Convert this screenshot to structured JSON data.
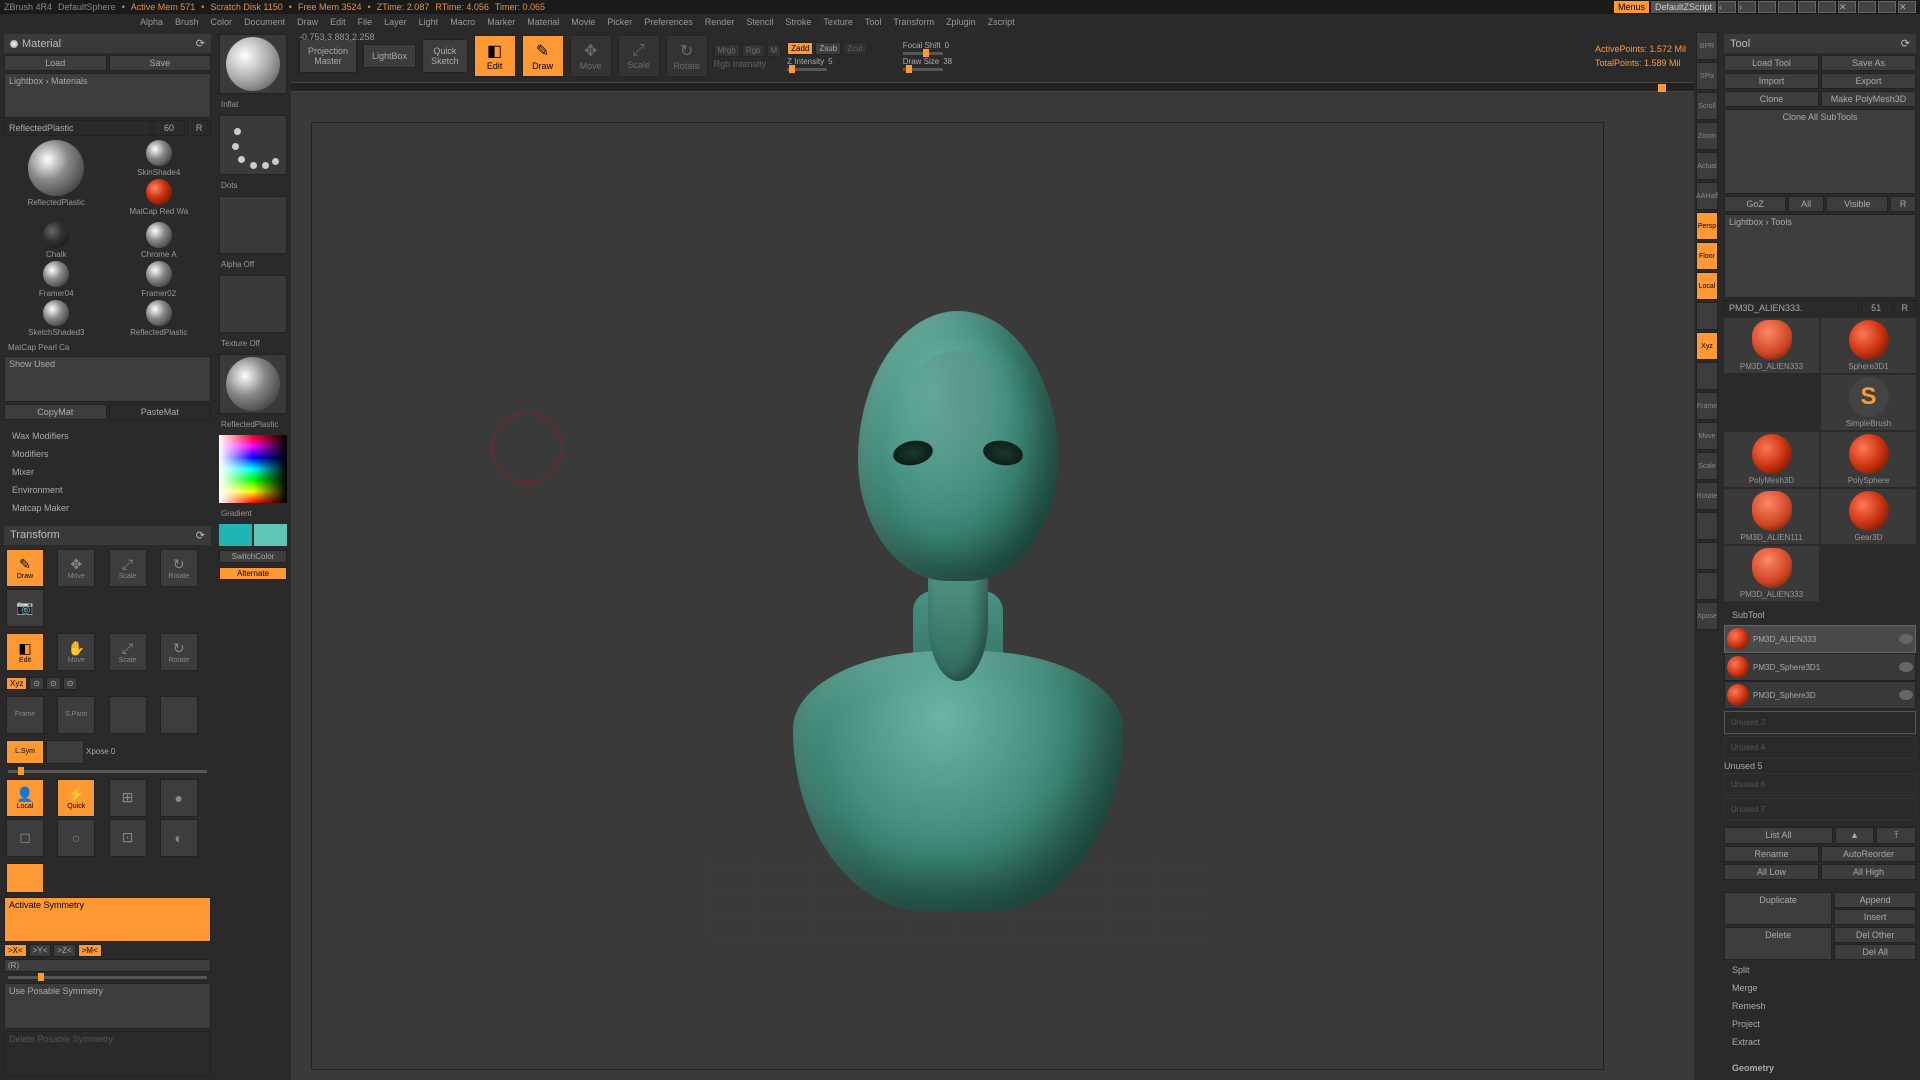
{
  "titlebar": {
    "app": "ZBrush 4R4",
    "doc": "DefaultSphere",
    "mem": "Active Mem 571",
    "scratch": "Scratch Disk 1150",
    "free": "Free Mem 3524",
    "ztime": "ZTime: 2.087",
    "rtime": "RTime: 4.056",
    "timer": "Timer: 0.065",
    "menus": "Menus",
    "script": "DefaultZScript"
  },
  "menubar": [
    "Alpha",
    "Brush",
    "Color",
    "Document",
    "Draw",
    "Edit",
    "File",
    "Layer",
    "Light",
    "Macro",
    "Marker",
    "Material",
    "Movie",
    "Picker",
    "Preferences",
    "Render",
    "Stencil",
    "Stroke",
    "Texture",
    "Tool",
    "Transform",
    "Zplugin",
    "Zscript"
  ],
  "coords": "-0.753,3.883,2.258",
  "topbar": {
    "projection": "Projection\nMaster",
    "lightbox": "LightBox",
    "quicksketch": "Quick\nSketch",
    "edit": "Edit",
    "draw": "Draw",
    "move": "Move",
    "scale": "Scale",
    "rotate": "Rotate",
    "mrgb": "Mrgb",
    "rgb": "Rgb",
    "m": "M",
    "rgbint": "Rgb Intensity",
    "zadd": "Zadd",
    "zsub": "Zsub",
    "zcut": "Zcut",
    "zint": "Z Intensity",
    "zintval": "5",
    "focal": "Focal Shift",
    "focalval": "0",
    "drawsize": "Draw Size",
    "drawsizeval": "38",
    "active": "ActivePoints: 1.572 Mil",
    "total": "TotalPoints: 1.589 Mil"
  },
  "material": {
    "title": "Material",
    "load": "Load",
    "save": "Save",
    "lightbox": "Lightbox › Materials",
    "count": "60",
    "r": "R",
    "reflected": "ReflectedPlastic",
    "items": [
      "ReflectedPlastic",
      "SkinShade4",
      "ReflectedPlastic",
      "MatCap Red Wa",
      "Chalk",
      "Chrome A",
      "Framer04",
      "Framer02",
      "SketchShaded3",
      "ReflectedPlastic",
      "MatCap Pearl Ca",
      ""
    ],
    "showused": "Show Used",
    "copymat": "CopyMat",
    "pastemat": "PasteMat",
    "sections": [
      "Wax Modifiers",
      "Modifiers",
      "Mixer",
      "Environment",
      "Matcap Maker"
    ]
  },
  "transform": {
    "title": "Transform",
    "draw": "Draw",
    "move": "Move",
    "scale": "Scale",
    "rotate": "Rotate",
    "edit": "Edit",
    "xyz": "Xyz",
    "frame": "Frame",
    "spivot": "S.Pivot",
    "xpose": "Xpose",
    "xposeval": "0",
    "lsym": "L.Sym",
    "local": "Local",
    "quick": "Quick",
    "activate": "Activate Symmetry",
    "sx": ">X<",
    "sy": ">Y<",
    "sz": ">Z<",
    "sm": ">M<",
    "rsym": "(R)",
    "posable": "Use Posable Symmetry"
  },
  "leftstrip": {
    "brush": "Inflat",
    "stroke": "Dots",
    "alpha": "Alpha Off",
    "texture": "Texture Off",
    "material": "ReflectedPlastic",
    "gradient": "Gradient",
    "switch": "SwitchColor",
    "alternate": "Alternate"
  },
  "rightstrip": [
    "BPR",
    "SPix",
    "Scroll",
    "Zoom",
    "Actual",
    "AAHalf",
    "Persp",
    "Floor",
    "Local",
    "",
    "Xyz",
    "",
    "Frame",
    "Move",
    "Scale",
    "Rotate",
    "",
    "",
    "",
    "Xpose"
  ],
  "tool": {
    "title": "Tool",
    "load": "Load Tool",
    "save": "Save As",
    "import": "Import",
    "export": "Export",
    "clone": "Clone",
    "makepm": "Make PolyMesh3D",
    "cloneall": "Clone All SubTools",
    "goz": "GoZ",
    "all": "All",
    "visible": "Visible",
    "r": "R",
    "lightbox": "Lightbox › Tools",
    "current": "PM3D_ALIEN333.",
    "count": "51",
    "rr": "R",
    "thumbs": [
      "PM3D_ALIEN333",
      "Sphere3D1",
      "SimpleBrush",
      "PolyMesh3D",
      "PolySphere",
      "PM3D_ALIEN111",
      "Gear3D",
      "PM3D_ALIEN333"
    ],
    "subtool_title": "SubTool",
    "subtools": [
      {
        "name": "PM3D_ALIEN333",
        "sel": true
      },
      {
        "name": "PM3D_Sphere3D1",
        "sel": false
      },
      {
        "name": "PM3D_Sphere3D",
        "sel": false
      }
    ],
    "unused": [
      "Unused 3",
      "Unused 4",
      "Unused 5",
      "Unused 6",
      "Unused 7"
    ],
    "listall": "List All",
    "rename": "Rename",
    "autoreorder": "AutoReorder",
    "alllow": "All Low",
    "allhigh": "All High",
    "duplicate": "Duplicate",
    "append": "Append",
    "insert": "Insert",
    "delete": "Delete",
    "delother": "Del Other",
    "delall": "Del All",
    "sections": [
      "Split",
      "Merge",
      "Remesh",
      "Project",
      "Extract"
    ],
    "geometry": "Geometry"
  }
}
